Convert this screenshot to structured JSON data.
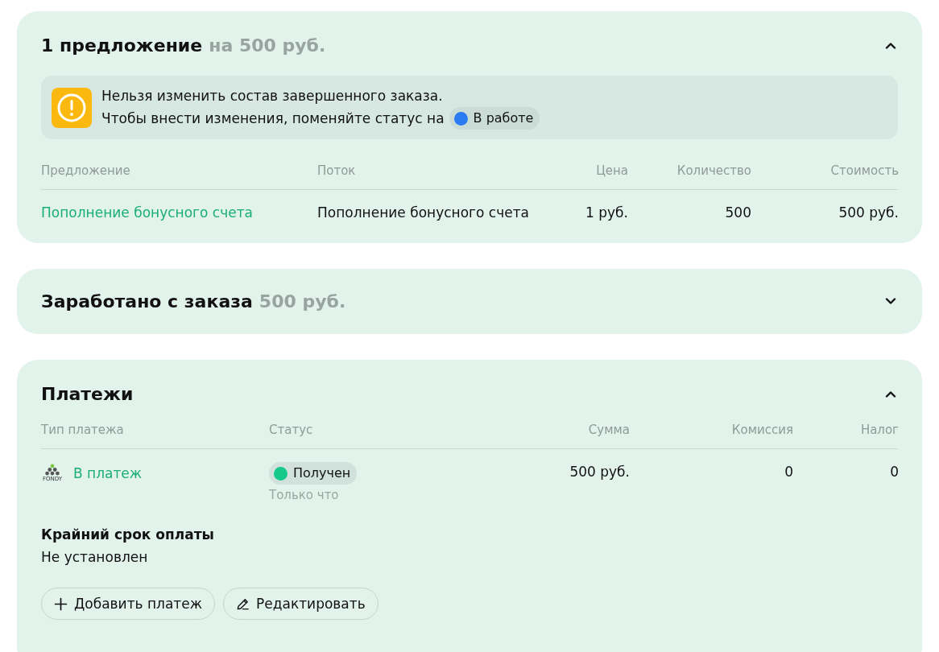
{
  "sections": [
    {
      "kind": "offers",
      "title": "1 предложение",
      "subtitle": "на 500 руб.",
      "expanded": true,
      "notice": {
        "lines": [
          "Нельзя изменить состав завершенного заказа.",
          "Чтобы внести изменения, поменяйте статус на"
        ],
        "status": {
          "label": "В работе",
          "color": "#2b7bf3"
        }
      },
      "table": {
        "columns": [
          "Предложение",
          "Поток",
          "Цена",
          "Количество",
          "Стоимость"
        ],
        "rows": [
          {
            "offer": "Пополнение бонусного счета",
            "flow": "Пополнение бонусного счета",
            "price": "1 руб.",
            "quantity": "500",
            "cost": "500 руб."
          }
        ]
      }
    },
    {
      "kind": "earned",
      "title": "Заработано с заказа",
      "subtitle": "500 руб.",
      "expanded": false
    },
    {
      "kind": "payments",
      "title": "Платежи",
      "expanded": true,
      "table": {
        "columns": [
          "Тип платежа",
          "Статус",
          "Сумма",
          "Комиссия",
          "Налог"
        ],
        "rows": [
          {
            "logo_text": "FONDY",
            "type": "В платеж",
            "status": {
              "label": "Получен",
              "color": "#14c98a"
            },
            "status_time": "Только что",
            "amount": "500 руб.",
            "commission": "0",
            "tax": "0"
          }
        ]
      },
      "deadline": {
        "label": "Крайний срок оплаты",
        "value": "Не установлен"
      },
      "buttons": [
        {
          "kind": "add",
          "label": "Добавить платеж"
        },
        {
          "kind": "edit",
          "label": "Редактировать"
        }
      ]
    }
  ]
}
